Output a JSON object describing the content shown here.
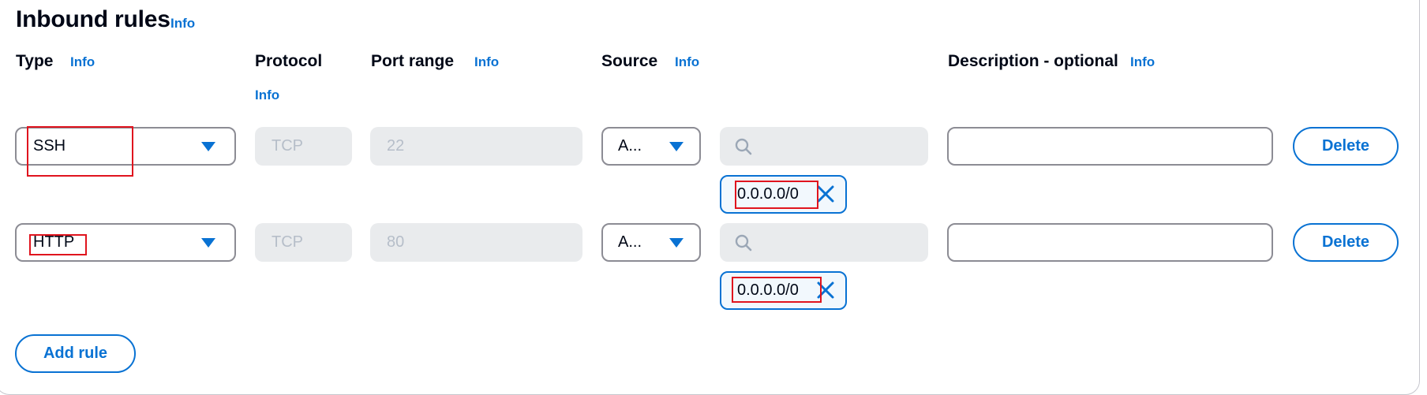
{
  "title": "Inbound rules",
  "info_label": "Info",
  "columns": {
    "type": "Type",
    "protocol": "Protocol",
    "port_range": "Port range",
    "source": "Source",
    "description": "Description - optional"
  },
  "rules": [
    {
      "type": "SSH",
      "protocol": "TCP",
      "port": "22",
      "source_type": "A...",
      "search_placeholder": "",
      "source_cidr": "0.0.0.0/0",
      "description": "",
      "delete_label": "Delete"
    },
    {
      "type": "HTTP",
      "protocol": "TCP",
      "port": "80",
      "source_type": "A...",
      "search_placeholder": "",
      "source_cidr": "0.0.0.0/0",
      "description": "",
      "delete_label": "Delete"
    }
  ],
  "add_rule_label": "Add rule",
  "colors": {
    "accent": "#0972d3",
    "highlight": "#e0141e",
    "disabled_bg": "#e9ebed"
  },
  "icons": [
    "caret-down-icon",
    "search-icon",
    "remove-token-icon"
  ]
}
